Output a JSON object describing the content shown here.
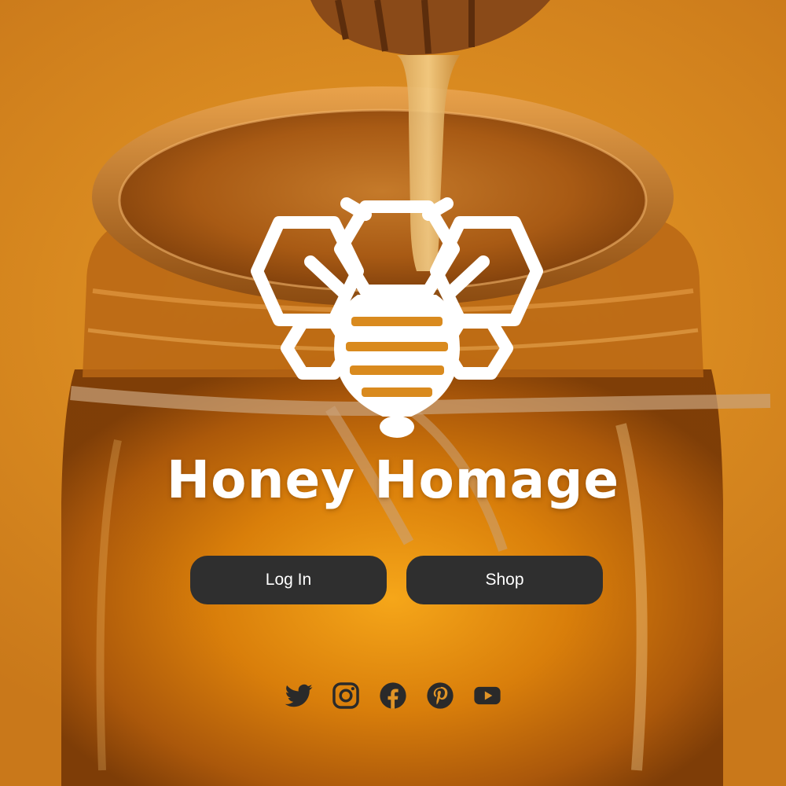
{
  "brand": {
    "title": "Honey Homage",
    "logo_icon": "bee-honeycomb-logo-icon"
  },
  "actions": {
    "login_label": "Log In",
    "shop_label": "Shop"
  },
  "social_links": [
    {
      "name": "twitter",
      "icon": "twitter-icon"
    },
    {
      "name": "instagram",
      "icon": "instagram-icon"
    },
    {
      "name": "facebook",
      "icon": "facebook-icon"
    },
    {
      "name": "pinterest",
      "icon": "pinterest-icon"
    },
    {
      "name": "youtube",
      "icon": "youtube-icon"
    }
  ],
  "colors": {
    "button_bg": "#2f2f2f",
    "button_text": "#ffffff",
    "title_text": "#ffffff",
    "icon_color": "#2a2a2a",
    "background_honey": "#e09426"
  },
  "background": {
    "description_icon": "honey-jar-background-image"
  }
}
